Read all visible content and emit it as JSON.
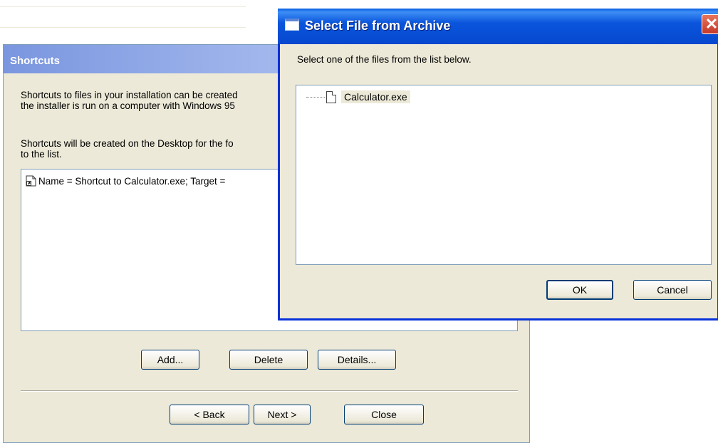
{
  "wizard": {
    "title": "Shortcuts",
    "intro_line1": "Shortcuts to files in your installation can be created",
    "intro_line2": "the installer is run on a computer with Windows 95",
    "desc_line1": "Shortcuts will be created on the Desktop for the fo",
    "desc_line2": "to the list.",
    "list_items": [
      {
        "label": "Name = Shortcut to Calculator.exe; Target = ",
        "icon": "shortcut-icon"
      }
    ],
    "add_label": "Add...",
    "delete_label": "Delete",
    "details_label": "Details...",
    "back_label": "< Back",
    "next_label": "Next >",
    "close_label": "Close"
  },
  "dialog": {
    "title": "Select File from Archive",
    "prompt": "Select one of the files from the list below.",
    "files": [
      {
        "label": "Calculator.exe",
        "icon": "file-icon",
        "selected": true
      }
    ],
    "ok_label": "OK",
    "cancel_label": "Cancel",
    "close_glyph": "✕"
  },
  "colors": {
    "titlebar_blue": "#0a55dc",
    "wizard_header": "#7a96df",
    "window_face": "#ece9d8"
  }
}
